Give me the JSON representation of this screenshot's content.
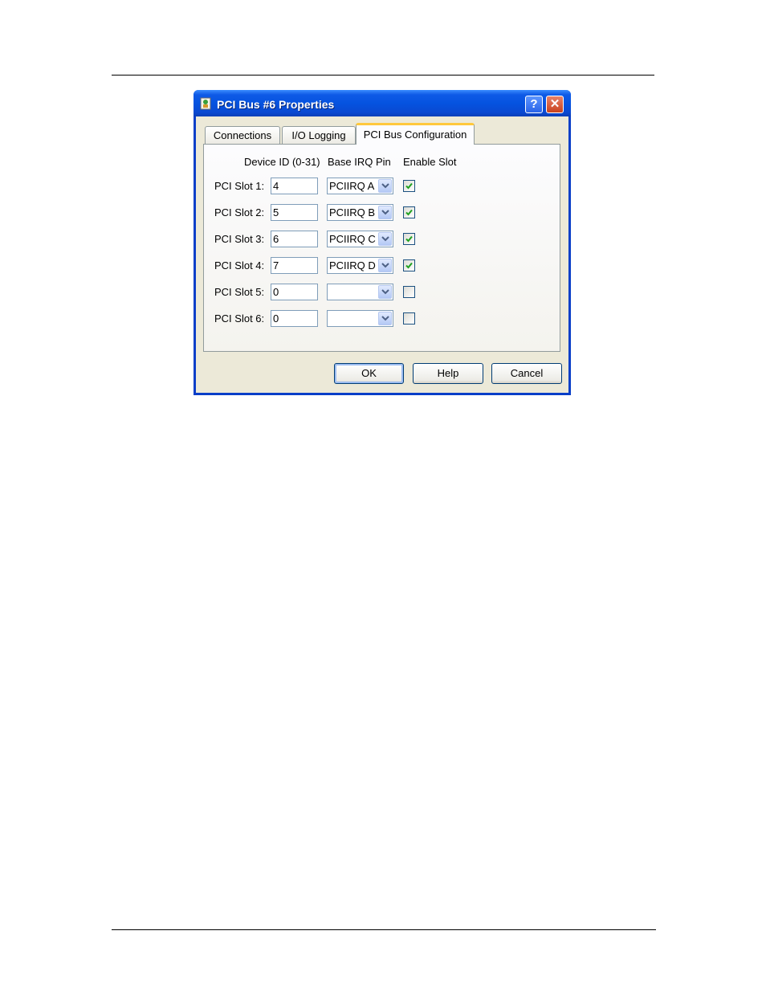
{
  "window": {
    "title": "PCI Bus #6 Properties",
    "help_glyph": "?",
    "close_glyph": "✕"
  },
  "tabs": [
    {
      "label": "Connections",
      "selected": false
    },
    {
      "label": "I/O Logging",
      "selected": false
    },
    {
      "label": "PCI Bus Configuration",
      "selected": true
    }
  ],
  "columns": {
    "device_id": "Device ID (0-31)",
    "base_irq": "Base IRQ Pin",
    "enable": "Enable Slot"
  },
  "slots": [
    {
      "label": "PCI Slot 1:",
      "device_id": "4",
      "irq": "PCIIRQ A",
      "enabled": true
    },
    {
      "label": "PCI Slot 2:",
      "device_id": "5",
      "irq": "PCIIRQ B",
      "enabled": true
    },
    {
      "label": "PCI Slot 3:",
      "device_id": "6",
      "irq": "PCIIRQ C",
      "enabled": true
    },
    {
      "label": "PCI Slot 4:",
      "device_id": "7",
      "irq": "PCIIRQ D",
      "enabled": true
    },
    {
      "label": "PCI Slot 5:",
      "device_id": "0",
      "irq": "",
      "enabled": false
    },
    {
      "label": "PCI Slot 6:",
      "device_id": "0",
      "irq": "",
      "enabled": false
    }
  ],
  "buttons": {
    "ok": "OK",
    "help": "Help",
    "cancel": "Cancel"
  },
  "colors": {
    "titlebar": "#0553e0",
    "tab_highlight": "#ffc83c",
    "check": "#21a121"
  }
}
